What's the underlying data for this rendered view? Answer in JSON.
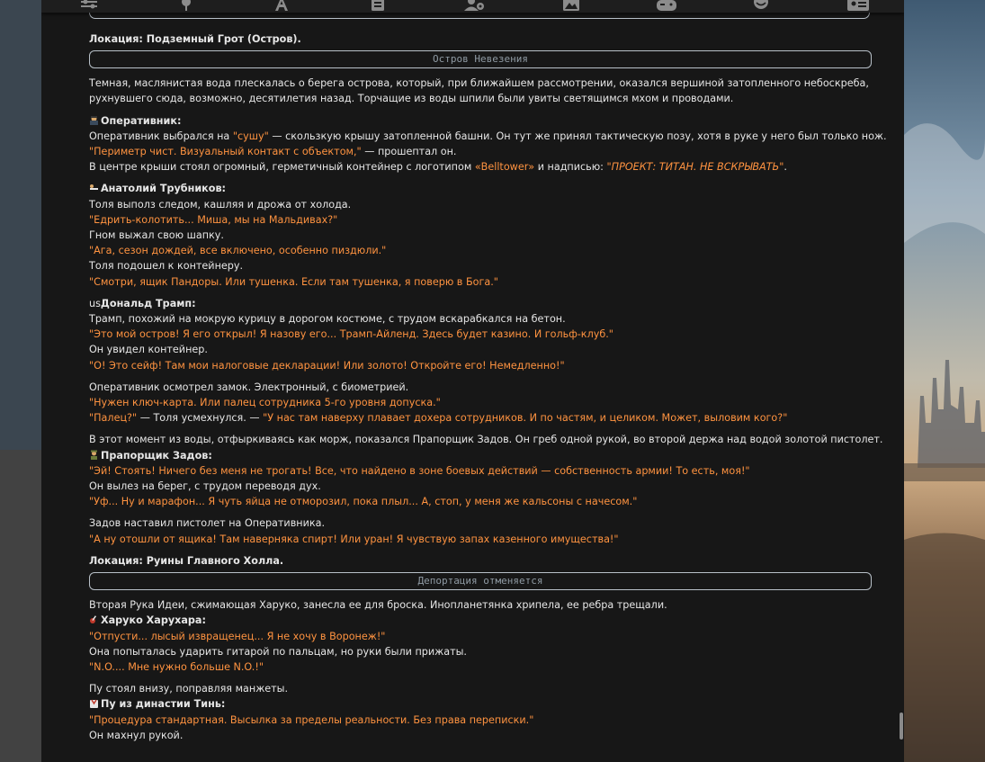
{
  "window": {
    "title": ""
  },
  "toolbar": {
    "icons": [
      "sliders-icon",
      "pin-icon",
      "font-icon",
      "notebook-icon",
      "user-settings-icon",
      "image-icon",
      "gamepad-icon",
      "smiley-icon",
      "id-card-icon"
    ]
  },
  "colors": {
    "accent_dialog": "#ff9340",
    "text": "#e6e6e6",
    "panel": "#171717",
    "banner_border": "#b8c0c8"
  },
  "story": {
    "loc1": "Локация: Подземный Грот (Остров).",
    "banner1": "Остров Невезения",
    "p1": "Темная, маслянистая вода плескалась о берега острова, который, при ближайшем рассмотрении, оказался вершиной затопленного небоскреба, рухнувшего сюда, возможно, десятилетия назад. Торчащие из воды шпили были увиты светящимся мхом и проводами.",
    "op_name": "Оперативник:",
    "op_l1a": "Оперативник выбрался на ",
    "op_l1b": "\"сушу\"",
    "op_l1c": " — скользкую крышу затопленной башни. Он тут же принял тактическую позу, хотя в руке у него был только нож.",
    "op_l2a": "\"Периметр чист. Визуальный контакт с объектом,\"",
    "op_l2b": " — прошептал он.",
    "op_l3a": "В центре крыши стоял огромный, герметичный контейнер с логотипом ",
    "op_l3b": "«Belltower»",
    "op_l3c": " и надписью: ",
    "op_l3d": "\"ПРОЕКТ: ТИТАН. НЕ ВСКРЫВАТЬ\"",
    "op_l3e": ".",
    "tol_name": "Анатолий Трубников:",
    "tol_l1": "Толя выполз следом, кашляя и дрожа от холода.",
    "tol_l2": "\"Едрить-колотить... Миша, мы на Мальдивах?\"",
    "tol_l3": "Гном выжал свою шапку.",
    "tol_l4": "\"Ага, сезон дождей, все включено, особенно пиздюли.\"",
    "tol_l5": "Толя подошел к контейнеру.",
    "tol_l6": "\"Смотри, ящик Пандоры. Или тушенка. Если там тушенка, я поверю в Бога.\"",
    "tr_flag": "us",
    "tr_name": "Дональд Трамп:",
    "tr_l1": "Трамп, похожий на мокрую курицу в дорогом костюме, с трудом вскарабкался на бетон.",
    "tr_l2": "\"Это мой остров! Я его открыл! Я назову его... Трамп-Айленд. Здесь будет казино. И гольф-клуб.\"",
    "tr_l3": "Он увидел контейнер.",
    "tr_l4": "\"О! Это сейф! Там мои налоговые декларации! Или золото! Откройте его! Немедленно!\"",
    "lock_l1": "Оперативник осмотрел замок. Электронный, с биометрией.",
    "lock_l2": "\"Нужен ключ-карта. Или палец сотрудника 5-го уровня допуска.\"",
    "lock_l3a": "\"Палец?\"",
    "lock_l3b": " — Толя усмехнулся. — ",
    "lock_l3c": "\"У нас там наверху плавает дохера сотрудников. И по частям, и целиком. Может, выловим кого?\"",
    "zad_intro": "В этот момент из воды, отфыркиваясь как морж, показался Прапорщик Задов. Он греб одной рукой, во второй держа над водой золотой пистолет.",
    "zad_name": "Прапорщик Задов:",
    "zad_l1": "\"Эй! Стоять! Ничего без меня не трогать! Все, что найдено в зоне боевых действий — собственность армии! То есть, моя!\"",
    "zad_l2": "Он вылез на берег, с трудом переводя дух.",
    "zad_l3": "\"Уф... Ну и марафон... Я чуть яйца не отморозил, пока плыл... А, стоп, у меня же кальсоны с начесом.\"",
    "zad_l4": "Задов наставил пистолет на Оперативника.",
    "zad_l5": "\"А ну отошли от ящика! Там наверняка спирт! Или уран! Я чувствую запах казенного имущества!\"",
    "loc2": "Локация: Руины Главного Холла.",
    "banner2": "Депортация отменяется",
    "har_intro": "Вторая Рука Идеи, сжимающая Харуко, занесла ее для броска. Инопланетянка хрипела, ее ребра трещали.",
    "har_name": "Харуко Харухара:",
    "har_l1": "\"Отпусти... лысый извращенец... Я не хочу в Воронеж!\"",
    "har_l2": "Она попыталась ударить гитарой по пальцам, но руки были прижаты.",
    "har_l3": "\"N.O.... Мне нужно больше N.O.!\"",
    "pu_intro": "Пу стоял внизу, поправляя манжеты.",
    "pu_name": "Пу из династии Тинь:",
    "pu_l1": "\"Процедура стандартная. Высылка за пределы реальности. Без права переписки.\"",
    "pu_l2": "Он махнул рукой."
  }
}
